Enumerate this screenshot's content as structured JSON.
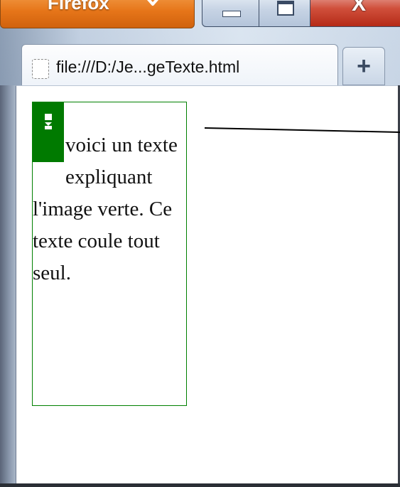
{
  "browser": {
    "app_button_label": "Firefox",
    "caption": {
      "close_label": "X"
    },
    "tab": {
      "title": "file:///D:/Je...geTexte.html",
      "favicon_icon": "dashed-page-icon"
    },
    "new_tab_label": "+"
  },
  "page": {
    "text": "voici un texte expliquant l'image verte. Ce texte coule tout seul.",
    "image_color": "#007a00",
    "border_color": "#008000"
  }
}
